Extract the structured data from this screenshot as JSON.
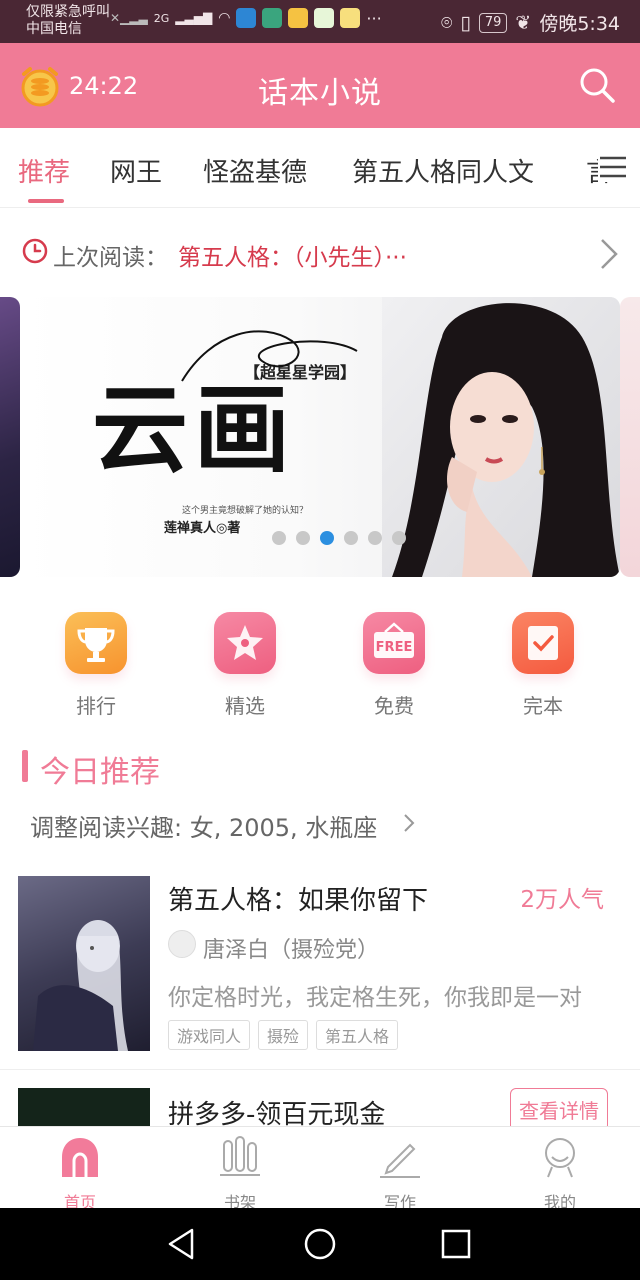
{
  "status_bar": {
    "carrier_line1": "仅限紧急呼叫",
    "carrier_line2": "中国电信",
    "network": "2G",
    "more": "···",
    "battery": "79",
    "time": "傍晚5:34"
  },
  "header": {
    "timer": "24:22",
    "title": "话本小说"
  },
  "tabs": [
    {
      "label": "推荐",
      "active": true
    },
    {
      "label": "网王"
    },
    {
      "label": "怪盗基德"
    },
    {
      "label": "第五人格同人文"
    },
    {
      "label": "言"
    }
  ],
  "last_read": {
    "label": "上次阅读：",
    "value": "第五人格：（小先生）···"
  },
  "banner": {
    "subtitle": "【超星星学园】",
    "title": "云画",
    "tagline": "这个男主竟想破解了她的认知？",
    "author": "莲禅真人◎著",
    "dots": 6,
    "active_dot": 2
  },
  "quick_entries": [
    {
      "label": "排行",
      "icon": "trophy-icon",
      "color": "#f7a23a"
    },
    {
      "label": "精选",
      "icon": "star-icon",
      "color": "#f06a8b"
    },
    {
      "label": "免费",
      "icon": "free-sign-icon",
      "color": "#f06a8b"
    },
    {
      "label": "完本",
      "icon": "checklist-icon",
      "color": "#f56a4a"
    }
  ],
  "today_section": {
    "title": "今日推荐",
    "interest": "调整阅读兴趣: 女, 2005, 水瓶座"
  },
  "book": {
    "title": "第五人格：如果你留下",
    "popularity": "2万人气",
    "author": "唐泽白（摄殓党）",
    "description": "你定格时光，我定格生死，你我即是一对",
    "tags": [
      "游戏同人",
      "摄殓",
      "第五人格"
    ]
  },
  "ad": {
    "title": "拼多多-领百元现金",
    "button": "查看详情"
  },
  "bottom_nav": [
    {
      "label": "首页",
      "icon": "home-icon",
      "active": true
    },
    {
      "label": "书架",
      "icon": "bookshelf-icon"
    },
    {
      "label": "写作",
      "icon": "pen-icon"
    },
    {
      "label": "我的",
      "icon": "profile-icon"
    }
  ],
  "colors": {
    "brand": "#f07b96",
    "accent_red": "#d63b4d",
    "status_bar": "#4a2734"
  }
}
